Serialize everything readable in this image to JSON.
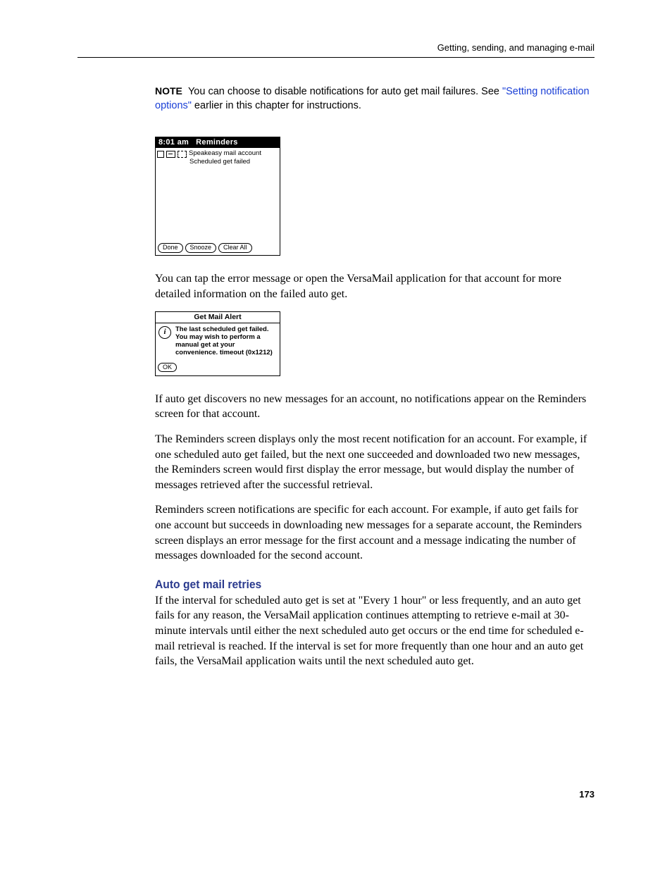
{
  "header": "Getting, sending, and managing e-mail",
  "note": {
    "label": "NOTE",
    "text_before_link": "You can choose to disable notifications for auto get mail failures. See ",
    "link_text": "\"Setting notification options\"",
    "text_after_link": " earlier in this chapter for instructions."
  },
  "reminders_screen": {
    "title_time": "8:01 am",
    "title_label": "Reminders",
    "row_text": "Speakeasy mail account",
    "row_sub": "Scheduled get failed",
    "btn_done": "Done",
    "btn_snooze": "Snooze",
    "btn_clear": "Clear All"
  },
  "para1": "You can tap the error message or open the VersaMail application for that account for more detailed information on the failed auto get.",
  "alert_screen": {
    "title": "Get Mail Alert",
    "icon_char": "i",
    "text": "The last scheduled get failed.  You may wish to perform a manual get at your convenience. timeout (0x1212)",
    "btn_ok": "OK"
  },
  "para2": "If auto get discovers no new messages for an account, no notifications appear on the Reminders screen for that account.",
  "para3": "The Reminders screen displays only the most recent notification for an account. For example, if one scheduled auto get failed, but the next one succeeded and downloaded two new messages, the Reminders screen would first display the error message, but would display the number of messages retrieved after the successful retrieval.",
  "para4": "Reminders screen notifications are specific for each account. For example, if auto get fails for one account but succeeds in downloading new messages for a separate account, the Reminders screen displays an error message for the first account and a message indicating the number of messages downloaded for the second account.",
  "section_heading": "Auto get mail retries",
  "para5": "If the interval for scheduled auto get is set at \"Every 1 hour\" or less frequently, and an auto get fails for any reason, the VersaMail application continues attempting to retrieve e-mail at 30-minute intervals until either the next scheduled auto get occurs or the end time for scheduled e-mail retrieval is reached. If the interval is set for more frequently than one hour and an auto get fails, the VersaMail application waits until the next scheduled auto get.",
  "page_number": "173"
}
